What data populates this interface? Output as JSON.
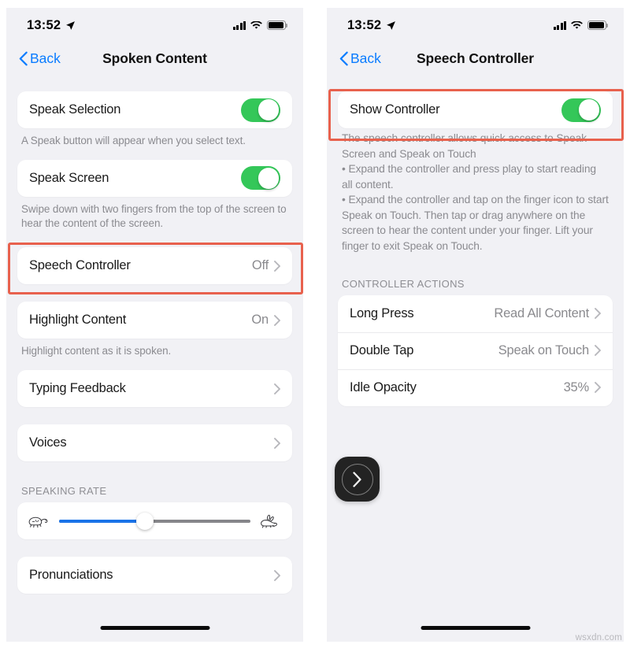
{
  "meta": {
    "watermark": "wsxdn.com"
  },
  "status_bar": {
    "time": "13:52",
    "location_icon": "location-arrow-icon",
    "cellular_icon": "cellular-bars-icon",
    "wifi_icon": "wifi-icon",
    "battery_icon": "battery-icon"
  },
  "left_screen": {
    "nav": {
      "back_label": "Back",
      "back_icon": "chevron-left-icon",
      "title": "Spoken Content"
    },
    "speak_selection": {
      "label": "Speak Selection",
      "toggle_state": "on",
      "footnote": "A Speak button will appear when you select text."
    },
    "speak_screen": {
      "label": "Speak Screen",
      "toggle_state": "on",
      "footnote": "Swipe down with two fingers from the top of the screen to hear the content of the screen."
    },
    "speech_controller": {
      "label": "Speech Controller",
      "value": "Off",
      "chevron_icon": "chevron-right-icon",
      "highlighted": true
    },
    "highlight_content": {
      "label": "Highlight Content",
      "value": "On",
      "chevron_icon": "chevron-right-icon",
      "footnote": "Highlight content as it is spoken."
    },
    "typing_feedback": {
      "label": "Typing Feedback",
      "chevron_icon": "chevron-right-icon"
    },
    "voices": {
      "label": "Voices",
      "chevron_icon": "chevron-right-icon"
    },
    "speaking_rate": {
      "section_header": "SPEAKING RATE",
      "slow_icon": "tortoise-icon",
      "fast_icon": "hare-icon",
      "value_percent": 45
    },
    "pronunciations": {
      "label": "Pronunciations",
      "chevron_icon": "chevron-right-icon"
    }
  },
  "right_screen": {
    "nav": {
      "back_label": "Back",
      "back_icon": "chevron-left-icon",
      "title": "Speech Controller"
    },
    "show_controller": {
      "label": "Show Controller",
      "toggle_state": "on",
      "highlighted": true
    },
    "description": "The speech controller allows quick access to Speak Screen and Speak on Touch\n • Expand the controller and press play to start reading all content.\n • Expand the controller and tap on the finger icon to start Speak on Touch. Then tap or drag anywhere on the screen to hear the content under your finger. Lift your finger to exit Speak on Touch.",
    "controller_actions": {
      "section_header": "CONTROLLER ACTIONS",
      "rows": [
        {
          "label": "Long Press",
          "value": "Read All Content",
          "chevron_icon": "chevron-right-icon"
        },
        {
          "label": "Double Tap",
          "value": "Speak on Touch",
          "chevron_icon": "chevron-right-icon"
        },
        {
          "label": "Idle Opacity",
          "value": "35%",
          "chevron_icon": "chevron-right-icon"
        }
      ]
    },
    "floating_controller": {
      "icon": "chevron-right-in-circle-icon"
    }
  },
  "colors": {
    "toggle_on": "#34C759",
    "accent_blue": "#0A7CFF",
    "slider_fill": "#1A73E8",
    "annotation_red": "#E8614D",
    "screen_background": "#F1F1F5"
  }
}
